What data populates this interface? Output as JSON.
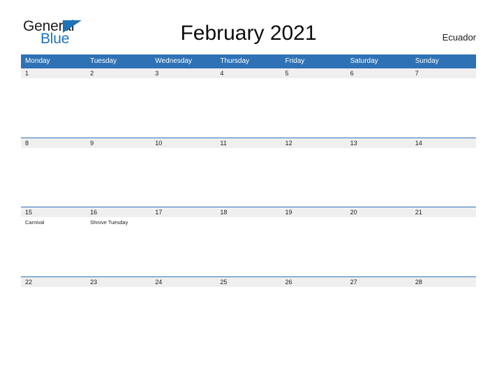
{
  "logo": {
    "text_primary": "General",
    "text_secondary": "Blue",
    "triangle_color": "#1f73b8"
  },
  "header": {
    "title": "February 2021",
    "locale": "Ecuador"
  },
  "theme": {
    "header_blue": "#2e72b5",
    "band_gray": "#efefef",
    "text_dark": "#1a1a1a",
    "logo_blue": "#1f73b8"
  },
  "calendar": {
    "weekdays": [
      "Monday",
      "Tuesday",
      "Wednesday",
      "Thursday",
      "Friday",
      "Saturday",
      "Sunday"
    ],
    "weeks": [
      {
        "days": [
          {
            "num": "1",
            "events": []
          },
          {
            "num": "2",
            "events": []
          },
          {
            "num": "3",
            "events": []
          },
          {
            "num": "4",
            "events": []
          },
          {
            "num": "5",
            "events": []
          },
          {
            "num": "6",
            "events": []
          },
          {
            "num": "7",
            "events": []
          }
        ]
      },
      {
        "days": [
          {
            "num": "8",
            "events": []
          },
          {
            "num": "9",
            "events": []
          },
          {
            "num": "10",
            "events": []
          },
          {
            "num": "11",
            "events": []
          },
          {
            "num": "12",
            "events": []
          },
          {
            "num": "13",
            "events": []
          },
          {
            "num": "14",
            "events": []
          }
        ]
      },
      {
        "days": [
          {
            "num": "15",
            "events": [
              "Carnival"
            ]
          },
          {
            "num": "16",
            "events": [
              "Shrove Tuesday"
            ]
          },
          {
            "num": "17",
            "events": []
          },
          {
            "num": "18",
            "events": []
          },
          {
            "num": "19",
            "events": []
          },
          {
            "num": "20",
            "events": []
          },
          {
            "num": "21",
            "events": []
          }
        ]
      },
      {
        "days": [
          {
            "num": "22",
            "events": []
          },
          {
            "num": "23",
            "events": []
          },
          {
            "num": "24",
            "events": []
          },
          {
            "num": "25",
            "events": []
          },
          {
            "num": "26",
            "events": []
          },
          {
            "num": "27",
            "events": []
          },
          {
            "num": "28",
            "events": []
          }
        ]
      }
    ]
  }
}
